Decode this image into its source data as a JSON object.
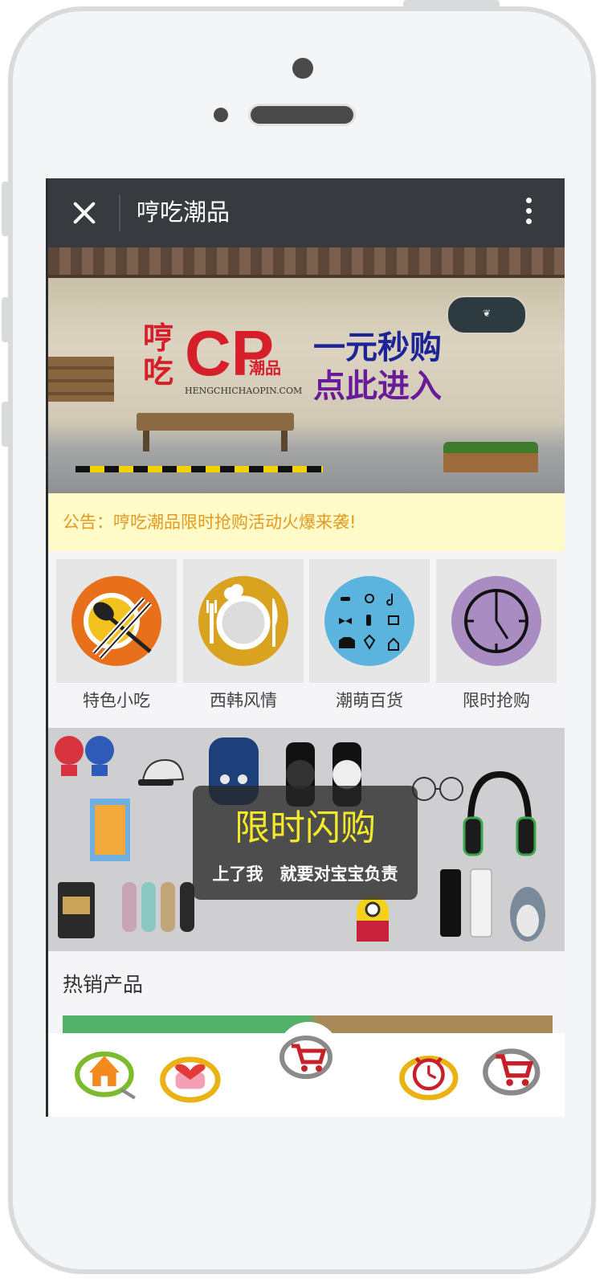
{
  "topbar": {
    "title": "哼吃潮品"
  },
  "banner": {
    "brand_han": "哼吃",
    "brand_cp": "CP",
    "brand_cp_sub": "潮品",
    "brand_url": "HENGCHICHAOPIN.COM",
    "promo_line1": "一元秒购",
    "promo_line2": "点此进入"
  },
  "notice": {
    "text": "公告：哼吃潮品限时抢购活动火爆来袭!"
  },
  "categories": [
    {
      "label": "特色小吃",
      "icon": "chopsticks-spoon-icon",
      "color": "#e8701a"
    },
    {
      "label": "西韩风情",
      "icon": "plate-fork-knife-icon",
      "color": "#d9a21f"
    },
    {
      "label": "潮萌百货",
      "icon": "goods-grid-icon",
      "color": "#5ab4dd"
    },
    {
      "label": "限时抢购",
      "icon": "clock-icon",
      "color": "#a98cc2"
    }
  ],
  "flash": {
    "title": "限时闪购",
    "subtitle": "上了我　就要对宝宝负责"
  },
  "hot": {
    "title": "热销产品"
  },
  "bottom_nav": [
    {
      "name": "home",
      "icon": "home-icon"
    },
    {
      "name": "favorites",
      "icon": "heart-icon"
    },
    {
      "name": "cart",
      "icon": "cart-icon"
    },
    {
      "name": "timer",
      "icon": "clock-icon"
    },
    {
      "name": "shopping",
      "icon": "cart-icon"
    }
  ]
}
